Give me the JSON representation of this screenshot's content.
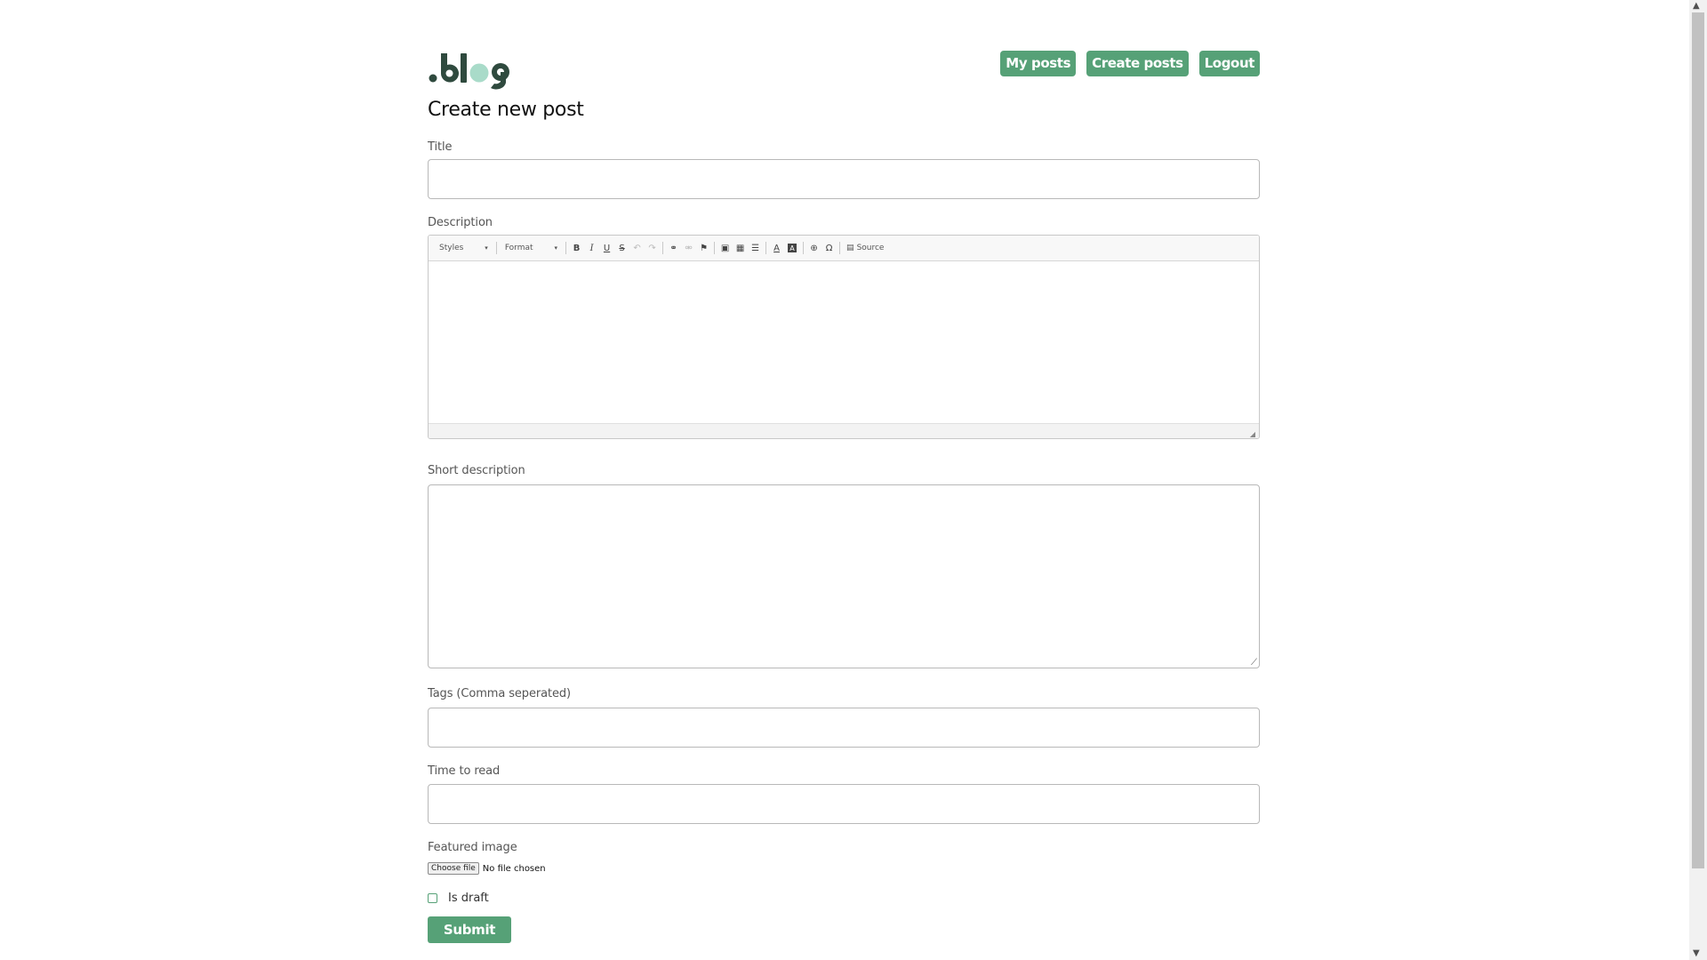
{
  "brand": {
    "logo_text": ".blog",
    "colors": {
      "primary": "#56a177",
      "logo_dark": "#2f4a3e",
      "logo_accent": "#a9dbc9"
    }
  },
  "nav": {
    "my_posts": "My posts",
    "create_posts": "Create posts",
    "logout": "Logout"
  },
  "page": {
    "title": "Create new post"
  },
  "form": {
    "title_label": "Title",
    "description_label": "Description",
    "short_description_label": "Short description",
    "tags_label": "Tags (Comma seperated)",
    "time_to_read_label": "Time to read",
    "featured_image_label": "Featured image",
    "file_button": "Choose file",
    "file_status": "No file chosen",
    "draft_label": "Is draft",
    "submit": "Submit"
  },
  "editor": {
    "styles_combo": "Styles",
    "format_combo": "Format",
    "source_label": "Source",
    "icons": [
      "bold-icon",
      "italic-icon",
      "underline-icon",
      "strikethrough-icon",
      "undo-icon",
      "redo-icon",
      "link-icon",
      "unlink-icon",
      "anchor-icon",
      "image-icon",
      "table-icon",
      "horizontal-rule-icon",
      "text-color-icon",
      "background-color-icon",
      "iframe-icon",
      "special-char-icon",
      "source-icon"
    ]
  }
}
